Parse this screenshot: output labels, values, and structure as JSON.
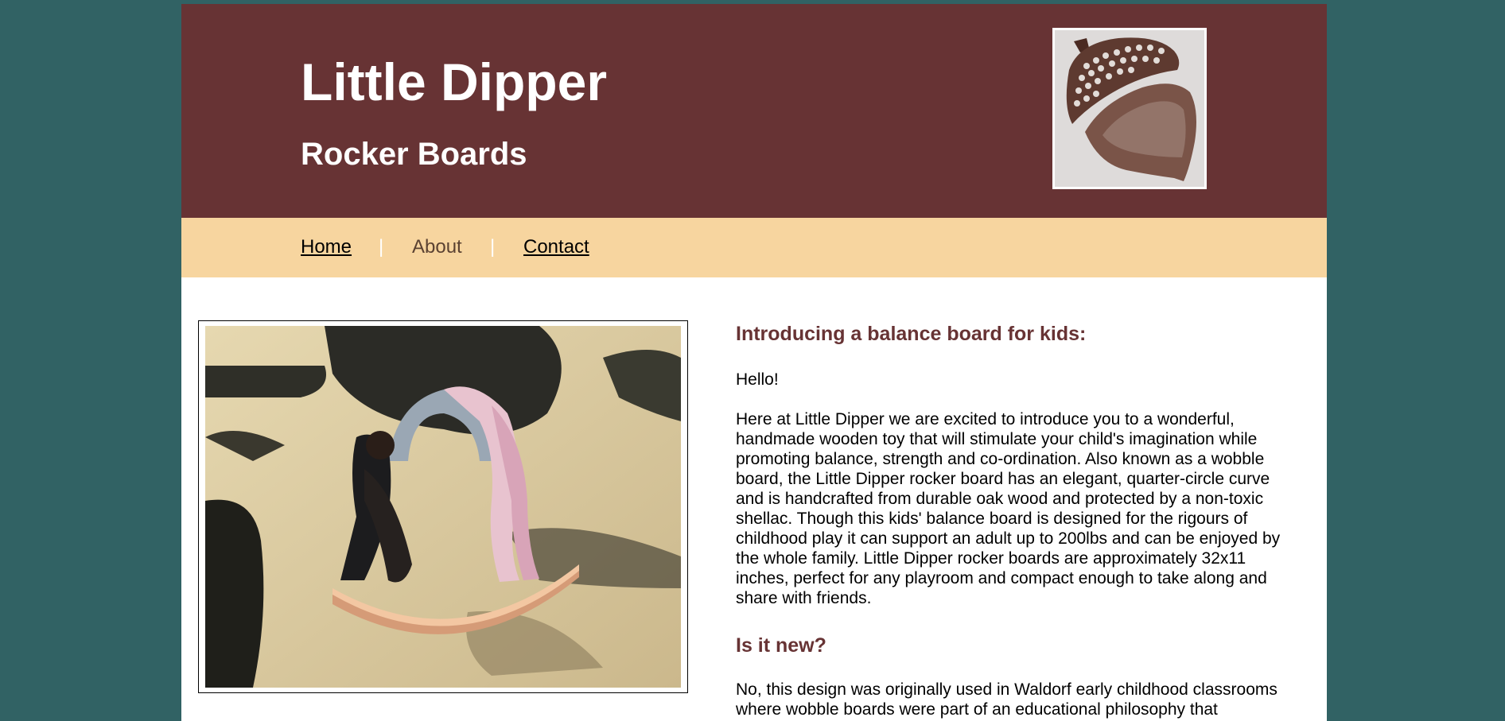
{
  "header": {
    "title": "Little Dipper",
    "subtitle": "Rocker Boards",
    "logo_icon": "acorn-stamp-icon"
  },
  "nav": {
    "items": [
      {
        "label": "Home"
      },
      {
        "label": "About"
      },
      {
        "label": "Contact"
      }
    ],
    "separator": "|"
  },
  "main": {
    "photo_icon": "girl-backbend-on-rocker-board-photo",
    "heading_intro": "Introducing a balance board for kids:",
    "greeting": "Hello!",
    "intro_paragraph": "Here at Little Dipper we are excited to introduce you to a wonderful, handmade wooden toy that will stimulate your child's imagination while promoting balance, strength and co-ordination. Also known as a wobble board, the Little Dipper rocker board has an elegant, quarter-circle curve and is handcrafted from durable oak wood and protected by a non-toxic shellac. Though this kids' balance board is designed for the rigours of childhood play it can support an adult up to 200lbs and can be enjoyed by the whole family. Little Dipper rocker boards are approximately 32x11 inches, perfect for any playroom and compact enough to take along and share with friends.",
    "heading_new": "Is it new?",
    "new_paragraph": "No, this design was originally used in Waldorf early childhood classrooms where wobble boards were part of an educational philosophy that"
  },
  "colors": {
    "background": "#316264",
    "header": "#673334",
    "nav": "#f7d59f",
    "heading": "#673334"
  }
}
